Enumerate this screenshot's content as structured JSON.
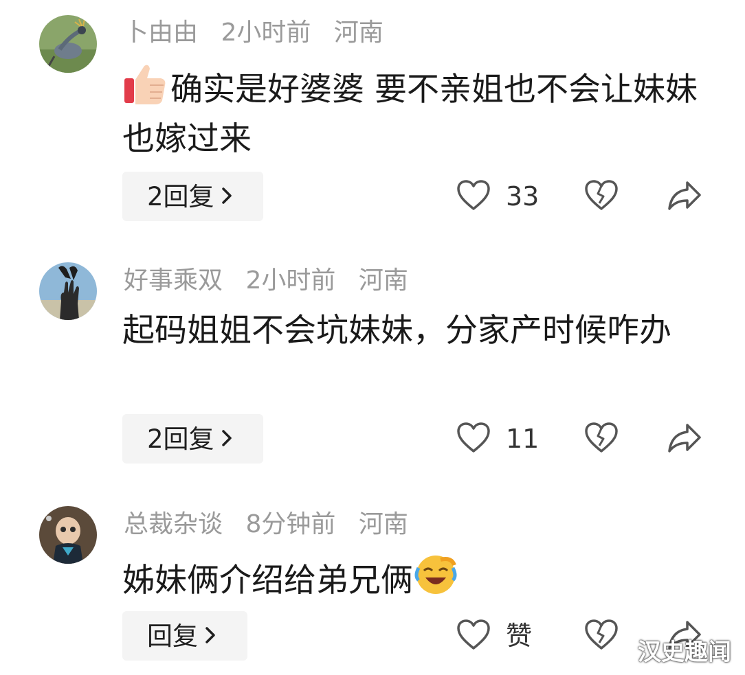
{
  "comments": [
    {
      "username": "卜由由",
      "time": "2小时前",
      "location": "河南",
      "text": "确实是好婆婆 要不亲姐也不会让妹妹也嫁过来",
      "emoji": "thumbs-up",
      "reply_label": "2回复",
      "likes": "33"
    },
    {
      "username": "好事乘双",
      "time": "2小时前",
      "location": "河南",
      "text": "起码姐姐不会坑妹妹，分家产时候咋办",
      "reply_label": "2回复",
      "likes": "11"
    },
    {
      "username": "总裁杂谈",
      "time": "8分钟前",
      "location": "河南",
      "text": "姊妹俩介绍给弟兄俩",
      "emoji": "laughing-crying",
      "reply_label": "回复",
      "likes": "赞"
    }
  ],
  "watermark": "汉史趣闻",
  "icons": {
    "like": "heart-outline-icon",
    "dislike": "broken-heart-icon",
    "share": "share-arrow-icon",
    "chevron": "chevron-right-icon"
  }
}
